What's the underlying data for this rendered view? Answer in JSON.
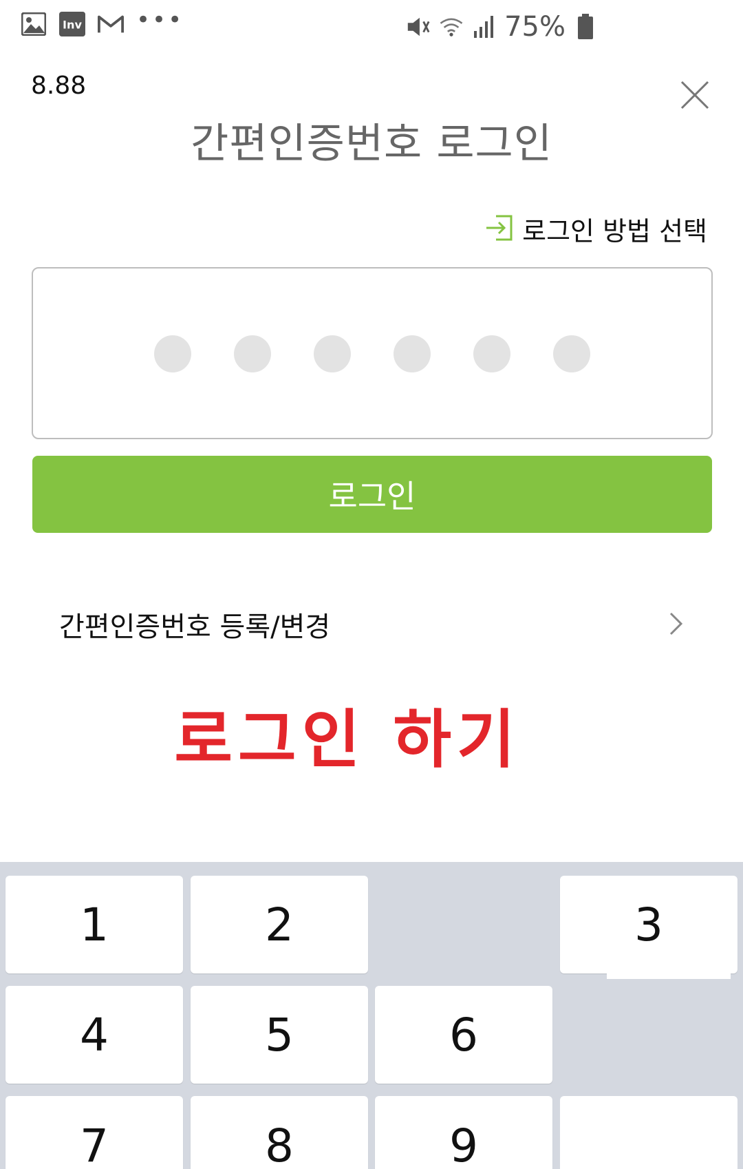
{
  "status_bar": {
    "left_icons": [
      "gallery-icon",
      "inv-app-icon",
      "gmail-icon"
    ],
    "inv_label": "Inv",
    "more_dots": "•••",
    "battery_percent": "75%",
    "right_icons": [
      "vibrate-mute-icon",
      "wifi-icon",
      "signal-icon",
      "battery-icon"
    ]
  },
  "version": "8.88",
  "title": "간편인증번호 로그인",
  "method_select": {
    "label": "로그인 방법 선택",
    "icon": "login-enter-icon"
  },
  "pin": {
    "length": 6,
    "filled": 0,
    "dot_color": "#e3e3e3"
  },
  "login_button": {
    "label": "로그인",
    "color": "#84c341"
  },
  "register": {
    "label": "간편인증번호 등록/변경"
  },
  "annotation": {
    "text": "로그인 하기",
    "color": "#e3262b"
  },
  "keypad": {
    "keys": [
      "1",
      "2",
      "3",
      "4",
      "5",
      "6",
      "7",
      "8",
      "9"
    ]
  }
}
